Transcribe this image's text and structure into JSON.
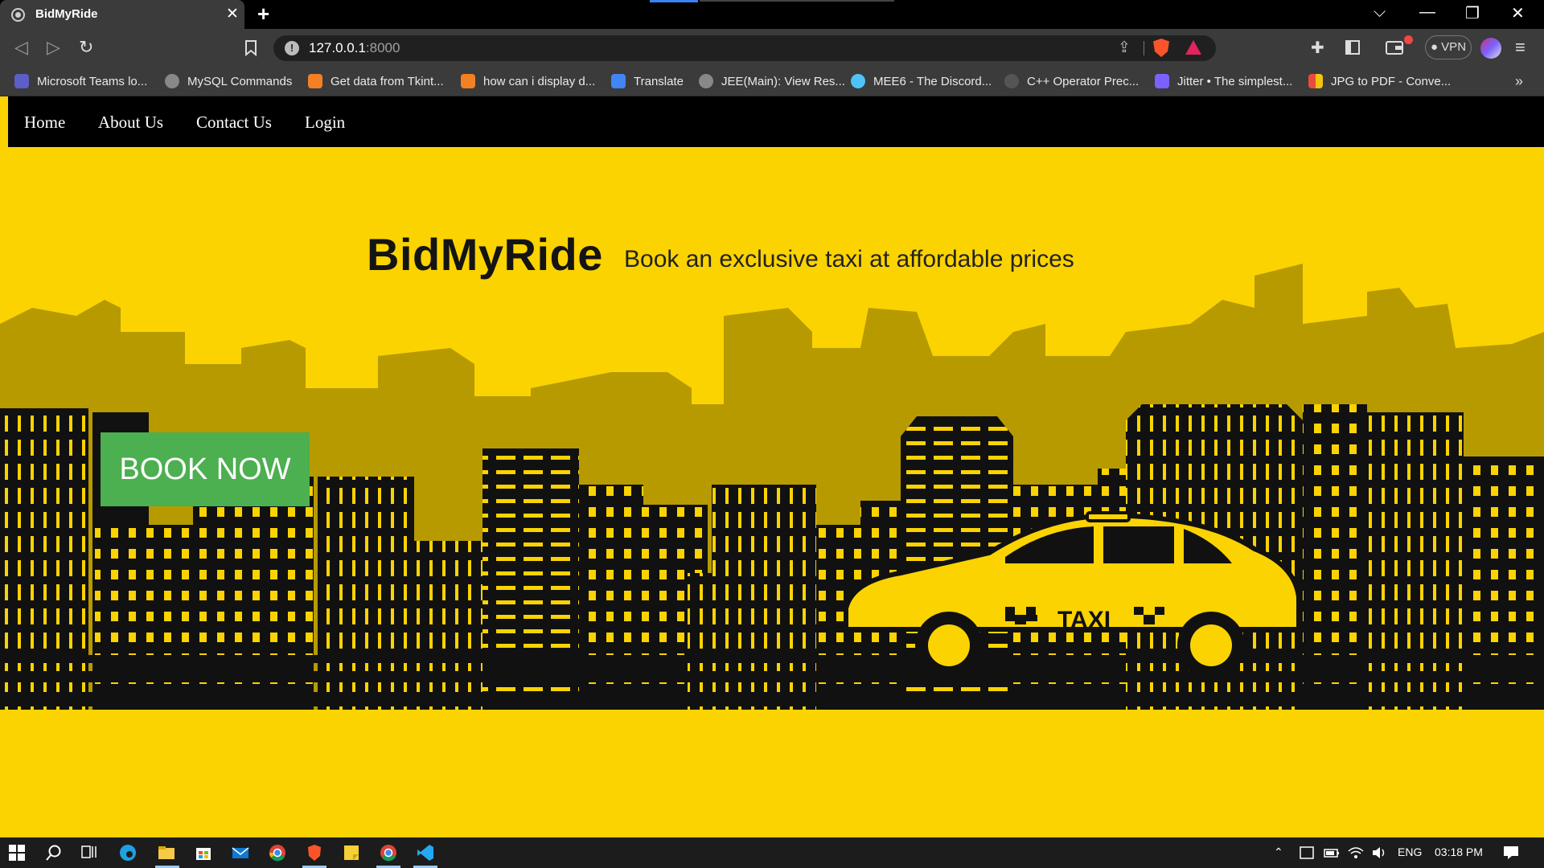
{
  "browser": {
    "tab": {
      "title": "BidMyRide",
      "close": "✕"
    },
    "new_tab": "+",
    "window_controls": {
      "tab_search": "⌵",
      "minimize": "—",
      "restore": "❐",
      "close": "✕"
    },
    "nav": {
      "back": "◁",
      "forward": "▷",
      "reload": "↻"
    },
    "address": {
      "host": "127.0.0.1",
      "port": ":8000"
    },
    "vpn_label": "● VPN",
    "menu": "≡",
    "bookmarks": [
      {
        "label": "Microsoft Teams lo...",
        "icon": "teams-icon",
        "color": "#5b5fc7"
      },
      {
        "label": "MySQL Commands",
        "icon": "globe-icon",
        "color": "#888888"
      },
      {
        "label": "Get data from Tkint...",
        "icon": "stackoverflow-icon",
        "color": "#f48024"
      },
      {
        "label": "how can i display d...",
        "icon": "stackoverflow-icon",
        "color": "#f48024"
      },
      {
        "label": "Translate",
        "icon": "translate-icon",
        "color": "#4285f4"
      },
      {
        "label": "JEE(Main): View Res...",
        "icon": "globe-icon",
        "color": "#888888"
      },
      {
        "label": "MEE6 - The Discord...",
        "icon": "mee6-icon",
        "color": "#4fc3f7"
      },
      {
        "label": "C++ Operator Prec...",
        "icon": "cppreference-icon",
        "color": "#555555"
      },
      {
        "label": "Jitter • The simplest...",
        "icon": "jitter-icon",
        "color": "#7b61ff"
      },
      {
        "label": "JPG to PDF - Conve...",
        "icon": "ilovepdf-icon",
        "color": "#e74c3c"
      }
    ],
    "bookmarks_more": "»"
  },
  "site": {
    "nav": [
      "Home",
      "About Us",
      "Contact Us",
      "Login"
    ],
    "brand": "BidMyRide",
    "tagline": "Book an exclusive taxi at affordable prices",
    "cta": "BOOK NOW",
    "taxi_sign": "TAXI",
    "colors": {
      "background": "#fbd300",
      "navbar": "#000000",
      "cta": "#4caf50",
      "taxi": "#fbd300"
    }
  },
  "taskbar": {
    "language": "ENG",
    "time": "03:18 PM"
  }
}
